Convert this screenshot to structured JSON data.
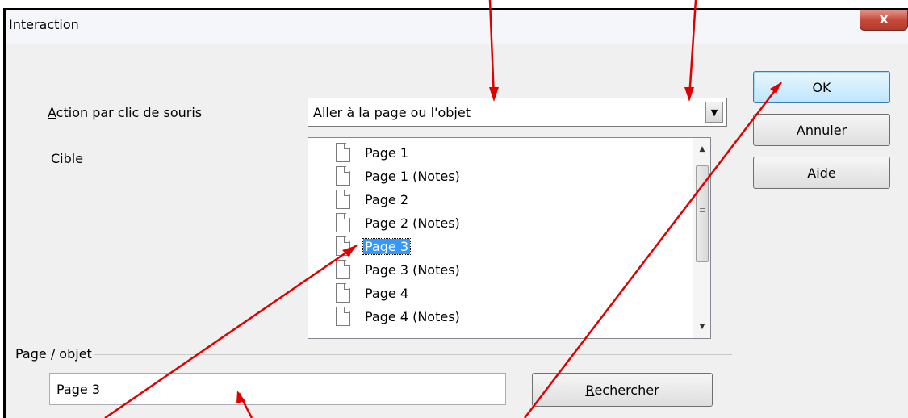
{
  "window": {
    "title": "Interaction",
    "close_symbol": "x"
  },
  "action": {
    "label_accel": "A",
    "label_rest": "ction par clic de souris",
    "value": "Aller à la page ou l'objet",
    "arrow_symbol": "▼"
  },
  "target": {
    "label": "Cible",
    "items": [
      {
        "label": "Page 1",
        "selected": false
      },
      {
        "label": "Page 1 (Notes)",
        "selected": false
      },
      {
        "label": "Page 2",
        "selected": false
      },
      {
        "label": "Page 2 (Notes)",
        "selected": false
      },
      {
        "label": "Page 3",
        "selected": true
      },
      {
        "label": "Page 3 (Notes)",
        "selected": false
      },
      {
        "label": "Page 4",
        "selected": false
      },
      {
        "label": "Page 4 (Notes)",
        "selected": false
      }
    ],
    "scroll_up_symbol": "▲",
    "scroll_down_symbol": "▼"
  },
  "buttons": {
    "ok": "OK",
    "cancel": "Annuler",
    "help": "Aide"
  },
  "page_object": {
    "label": "Page / objet",
    "value": "Page 3",
    "search_accel": "R",
    "search_rest": "echercher"
  },
  "colors": {
    "selection": "#3399ff",
    "annotation_arrows": "#e00000",
    "close_button": "#c7493a"
  }
}
